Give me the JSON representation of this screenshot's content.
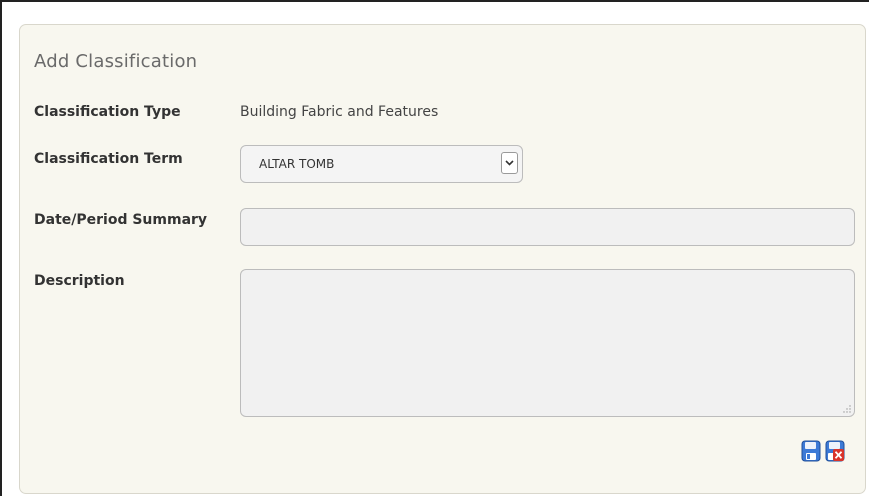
{
  "form": {
    "title": "Add Classification",
    "classification_type": {
      "label": "Classification Type",
      "value": "Building Fabric and Features"
    },
    "classification_term": {
      "label": "Classification Term",
      "selected": "ALTAR TOMB"
    },
    "date_period_summary": {
      "label": "Date/Period Summary",
      "value": ""
    },
    "description": {
      "label": "Description",
      "value": ""
    }
  },
  "actions": {
    "save_icon": "floppy-disk-icon",
    "cancel_icon": "floppy-disk-delete-icon"
  },
  "colors": {
    "panel_background": "#f8f7ef",
    "save_blue": "#3d7ad6",
    "delete_red": "#d9342b"
  }
}
